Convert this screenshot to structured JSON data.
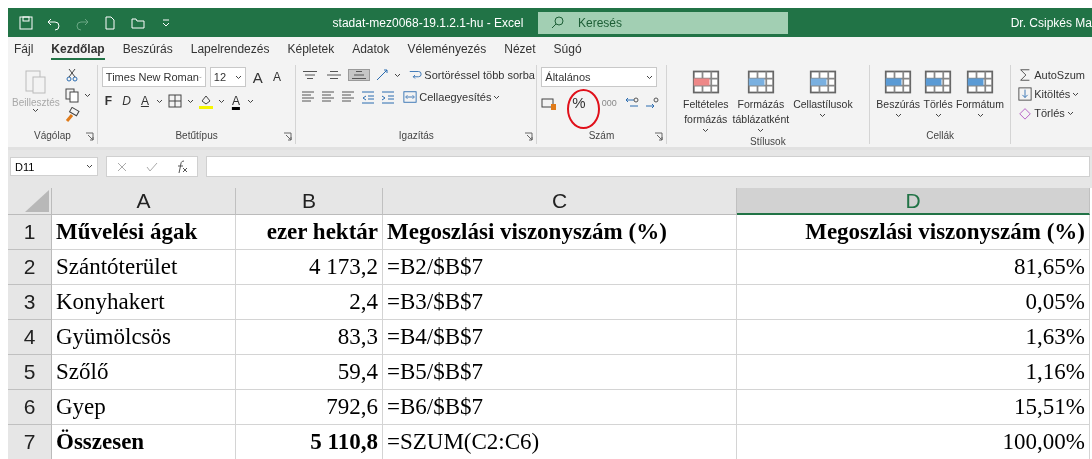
{
  "window": {
    "title": "stadat-mez0068-19.1.2.1-hu  -  Excel",
    "search": {
      "placeholder": "Keresés"
    },
    "user": "Dr. Csipkés Ma"
  },
  "menu_tabs": [
    {
      "label": "Fájl",
      "selected": false
    },
    {
      "label": "Kezdőlap",
      "selected": true
    },
    {
      "label": "Beszúrás",
      "selected": false
    },
    {
      "label": "Lapelrendezés",
      "selected": false
    },
    {
      "label": "Képletek",
      "selected": false
    },
    {
      "label": "Adatok",
      "selected": false
    },
    {
      "label": "Véleményezés",
      "selected": false
    },
    {
      "label": "Nézet",
      "selected": false
    },
    {
      "label": "Súgó",
      "selected": false
    }
  ],
  "ribbon": {
    "clipboard": {
      "label": "Vágólap",
      "paste": {
        "label": "Beillesztés",
        "disabled": true
      }
    },
    "font": {
      "label": "Betűtípus",
      "family": "Times New Roman",
      "size": "12",
      "size_buttons": [
        "A",
        "A"
      ],
      "style_buttons": [
        {
          "label": "F",
          "kind": "bold"
        },
        {
          "label": "D",
          "kind": "italic"
        },
        {
          "label": "A",
          "kind": "underline"
        }
      ],
      "color_button": "A"
    },
    "alignment": {
      "label": "Igazítás",
      "vertical": [
        {
          "kind": "top",
          "selected": false
        },
        {
          "kind": "middle",
          "selected": false
        },
        {
          "kind": "bottom",
          "selected": true
        }
      ],
      "wrap": "Sortöréssel több sorba",
      "merge": "Cellaegyesítés"
    },
    "number": {
      "label": "Szám",
      "format": "Általános",
      "percent": "%",
      "thousands": "000"
    },
    "styles": {
      "label": "Stílusok",
      "buttons": [
        {
          "lines": [
            "Feltételes",
            "formázás"
          ]
        },
        {
          "lines": [
            "Formázás",
            "táblázatként"
          ]
        },
        {
          "lines": [
            "Cellastílusok"
          ]
        }
      ]
    },
    "cells": {
      "label": "Cellák",
      "buttons": [
        "Beszúrás",
        "Törlés",
        "Formátum"
      ]
    },
    "editing": {
      "buttons": [
        "AutoSzum",
        "Kitöltés",
        "Törlés"
      ]
    }
  },
  "formula_bar": {
    "name_box": "D11"
  },
  "sheet": {
    "columns": [
      {
        "label": "A",
        "selected": false
      },
      {
        "label": "B",
        "selected": false
      },
      {
        "label": "C",
        "selected": false
      },
      {
        "label": "D",
        "selected": true
      }
    ],
    "rows": [
      {
        "number": "1",
        "cells": [
          {
            "text": "Művelési ágak",
            "bold": true
          },
          {
            "text": "ezer hektár",
            "bold": true
          },
          {
            "text": "Megoszlási viszonyszám (%)",
            "bold": true
          },
          {
            "text": "Megoszlási viszonyszám (%)",
            "bold": true
          }
        ]
      },
      {
        "number": "2",
        "cells": [
          {
            "text": "Szántóterület",
            "bold": false
          },
          {
            "text": "4 173,2",
            "bold": false
          },
          {
            "text": "=B2/$B$7",
            "bold": false
          },
          {
            "text": "81,65%",
            "bold": false
          }
        ]
      },
      {
        "number": "3",
        "cells": [
          {
            "text": "Konyhakert",
            "bold": false
          },
          {
            "text": "2,4",
            "bold": false
          },
          {
            "text": "=B3/$B$7",
            "bold": false
          },
          {
            "text": "0,05%",
            "bold": false
          }
        ]
      },
      {
        "number": "4",
        "cells": [
          {
            "text": "Gyümölcsös",
            "bold": false
          },
          {
            "text": "83,3",
            "bold": false
          },
          {
            "text": "=B4/$B$7",
            "bold": false
          },
          {
            "text": "1,63%",
            "bold": false
          }
        ]
      },
      {
        "number": "5",
        "cells": [
          {
            "text": "Szőlő",
            "bold": false
          },
          {
            "text": "59,4",
            "bold": false
          },
          {
            "text": "=B5/$B$7",
            "bold": false
          },
          {
            "text": "1,16%",
            "bold": false
          }
        ]
      },
      {
        "number": "6",
        "cells": [
          {
            "text": "Gyep",
            "bold": false
          },
          {
            "text": "792,6",
            "bold": false
          },
          {
            "text": "=B6/$B$7",
            "bold": false
          },
          {
            "text": "15,51%",
            "bold": false
          }
        ]
      },
      {
        "number": "7",
        "cells": [
          {
            "text": "Összesen",
            "bold": true
          },
          {
            "text": "5 110,8",
            "bold": true
          },
          {
            "text": "=SZUM(C2:C6)",
            "bold": false
          },
          {
            "text": "100,00%",
            "bold": false
          }
        ]
      }
    ]
  }
}
